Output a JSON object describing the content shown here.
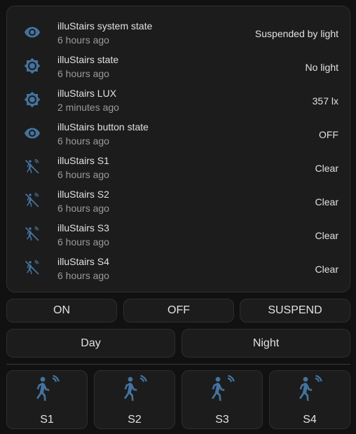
{
  "entities": [
    {
      "name": "illuStairs system state",
      "time": "6 hours ago",
      "state": "Suspended by light",
      "icon": "eye-icon"
    },
    {
      "name": "illuStairs state",
      "time": "6 hours ago",
      "state": "No light",
      "icon": "brightness-icon"
    },
    {
      "name": "illuStairs LUX",
      "time": "2 minutes ago",
      "state": "357 lx",
      "icon": "brightness-icon"
    },
    {
      "name": "illuStairs button state",
      "time": "6 hours ago",
      "state": "OFF",
      "icon": "eye-icon"
    },
    {
      "name": "illuStairs S1",
      "time": "6 hours ago",
      "state": "Clear",
      "icon": "motion-sensor-off-icon"
    },
    {
      "name": "illuStairs S2",
      "time": "6 hours ago",
      "state": "Clear",
      "icon": "motion-sensor-off-icon"
    },
    {
      "name": "illuStairs S3",
      "time": "6 hours ago",
      "state": "Clear",
      "icon": "motion-sensor-off-icon"
    },
    {
      "name": "illuStairs S4",
      "time": "6 hours ago",
      "state": "Clear",
      "icon": "motion-sensor-off-icon"
    }
  ],
  "mode_buttons": {
    "on": "ON",
    "off": "OFF",
    "suspend": "SUSPEND"
  },
  "time_buttons": {
    "day": "Day",
    "night": "Night"
  },
  "sensor_buttons": [
    {
      "label": "S1",
      "icon": "motion-sensor-icon"
    },
    {
      "label": "S2",
      "icon": "motion-sensor-icon"
    },
    {
      "label": "S3",
      "icon": "motion-sensor-icon"
    },
    {
      "label": "S4",
      "icon": "motion-sensor-icon"
    }
  ],
  "colors": {
    "accent": "#44739e",
    "background": "#111111",
    "card": "#1c1c1c",
    "text": "#e1e1e1",
    "secondary_text": "#9b9b9b"
  }
}
